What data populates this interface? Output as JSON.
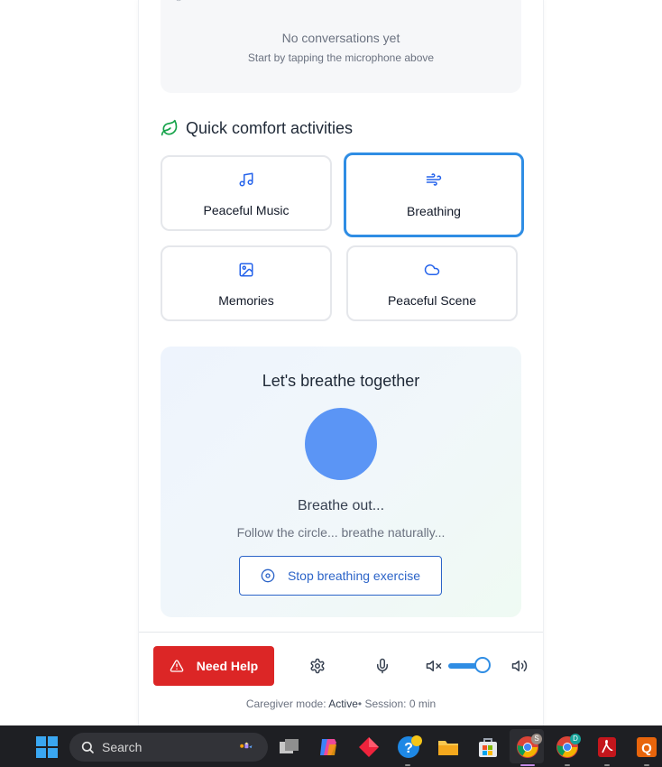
{
  "conversations": {
    "empty_title": "No conversations yet",
    "empty_hint": "Start by tapping the microphone above"
  },
  "activities": {
    "title": "Quick comfort activities",
    "items": [
      {
        "label": "Peaceful Music",
        "icon": "music-note-icon"
      },
      {
        "label": "Breathing",
        "icon": "wind-icon",
        "selected": true
      },
      {
        "label": "Memories",
        "icon": "images-icon"
      },
      {
        "label": "Peaceful Scene",
        "icon": "cloud-icon"
      }
    ]
  },
  "breathing": {
    "title": "Let's breathe together",
    "phase": "Breathe out...",
    "hint": "Follow the circle... breathe naturally...",
    "stop_label": "Stop breathing exercise"
  },
  "controls": {
    "help_label": "Need Help",
    "volume_level": 0.85
  },
  "status": {
    "caregiver_prefix": "Caregiver mode:",
    "caregiver_value": "Active",
    "separator": "•",
    "session": "Session: 0 min"
  },
  "taskbar": {
    "search_label": "Search"
  },
  "colors": {
    "accent": "#2f8de4",
    "danger": "#dc2626",
    "breath_circle": "#5b95f5",
    "leaf": "#16a34a"
  }
}
